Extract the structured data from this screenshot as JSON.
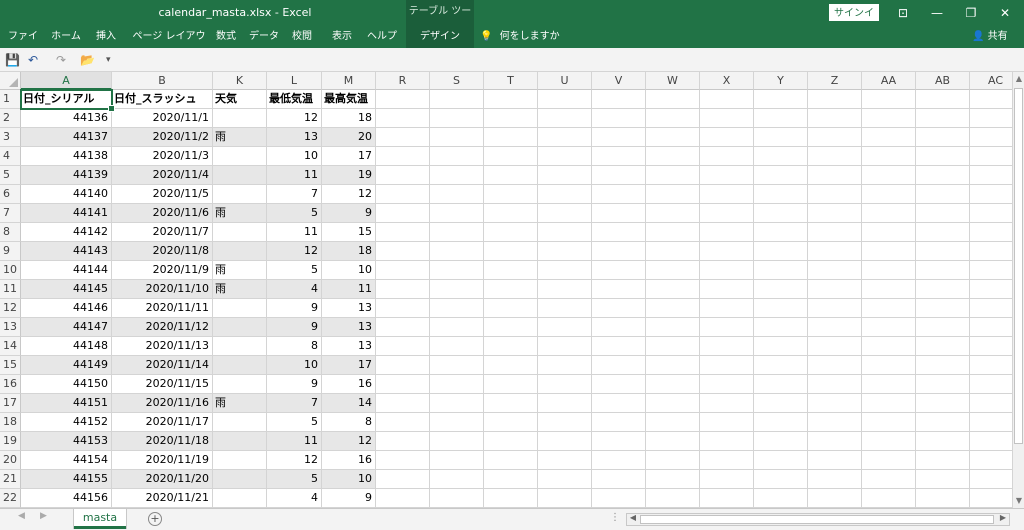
{
  "window": {
    "title": "calendar_masta.xlsx  -  Excel",
    "contextual_tab_label": "テーブル ツール",
    "signin_label": "サインイン",
    "controls": {
      "ribbon_options": "⊡",
      "minimize": "—",
      "restore": "❐",
      "close": "✕"
    }
  },
  "ribbon": {
    "tabs": [
      "ファイル",
      "ホーム",
      "挿入",
      "ページ レイアウト",
      "数式",
      "データ",
      "校閲",
      "表示",
      "ヘルプ",
      "デザイン"
    ],
    "tell_me": "何をしますか",
    "share": "共有"
  },
  "qat": {
    "save": "💾",
    "undo": "↶",
    "redo": "↷",
    "open": "📂",
    "customize": "▾"
  },
  "grid": {
    "columns": [
      "A",
      "B",
      "K",
      "L",
      "M",
      "R",
      "S",
      "T",
      "U",
      "V",
      "W",
      "X",
      "Y",
      "Z",
      "AA",
      "AB",
      "AC"
    ],
    "table_header": [
      "日付_シリアル",
      "日付_スラッシュ",
      "天気",
      "最低気温",
      "最高気温"
    ],
    "rows": [
      {
        "n": "2",
        "a": "44136",
        "b": "2020/11/1",
        "k": "",
        "l": "12",
        "m": "18"
      },
      {
        "n": "3",
        "a": "44137",
        "b": "2020/11/2",
        "k": "雨",
        "l": "13",
        "m": "20"
      },
      {
        "n": "4",
        "a": "44138",
        "b": "2020/11/3",
        "k": "",
        "l": "10",
        "m": "17"
      },
      {
        "n": "5",
        "a": "44139",
        "b": "2020/11/4",
        "k": "",
        "l": "11",
        "m": "19"
      },
      {
        "n": "6",
        "a": "44140",
        "b": "2020/11/5",
        "k": "",
        "l": "7",
        "m": "12"
      },
      {
        "n": "7",
        "a": "44141",
        "b": "2020/11/6",
        "k": "雨",
        "l": "5",
        "m": "9"
      },
      {
        "n": "8",
        "a": "44142",
        "b": "2020/11/7",
        "k": "",
        "l": "11",
        "m": "15"
      },
      {
        "n": "9",
        "a": "44143",
        "b": "2020/11/8",
        "k": "",
        "l": "12",
        "m": "18"
      },
      {
        "n": "10",
        "a": "44144",
        "b": "2020/11/9",
        "k": "雨",
        "l": "5",
        "m": "10"
      },
      {
        "n": "11",
        "a": "44145",
        "b": "2020/11/10",
        "k": "雨",
        "l": "4",
        "m": "11"
      },
      {
        "n": "12",
        "a": "44146",
        "b": "2020/11/11",
        "k": "",
        "l": "9",
        "m": "13"
      },
      {
        "n": "13",
        "a": "44147",
        "b": "2020/11/12",
        "k": "",
        "l": "9",
        "m": "13"
      },
      {
        "n": "14",
        "a": "44148",
        "b": "2020/11/13",
        "k": "",
        "l": "8",
        "m": "13"
      },
      {
        "n": "15",
        "a": "44149",
        "b": "2020/11/14",
        "k": "",
        "l": "10",
        "m": "17"
      },
      {
        "n": "16",
        "a": "44150",
        "b": "2020/11/15",
        "k": "",
        "l": "9",
        "m": "16"
      },
      {
        "n": "17",
        "a": "44151",
        "b": "2020/11/16",
        "k": "雨",
        "l": "7",
        "m": "14"
      },
      {
        "n": "18",
        "a": "44152",
        "b": "2020/11/17",
        "k": "",
        "l": "5",
        "m": "8"
      },
      {
        "n": "19",
        "a": "44153",
        "b": "2020/11/18",
        "k": "",
        "l": "11",
        "m": "12"
      },
      {
        "n": "20",
        "a": "44154",
        "b": "2020/11/19",
        "k": "",
        "l": "12",
        "m": "16"
      },
      {
        "n": "21",
        "a": "44155",
        "b": "2020/11/20",
        "k": "",
        "l": "5",
        "m": "10"
      },
      {
        "n": "22",
        "a": "44156",
        "b": "2020/11/21",
        "k": "",
        "l": "4",
        "m": "9"
      }
    ]
  },
  "sheets": {
    "nav_prev": "◀",
    "nav_next": "▶",
    "tabs": [
      "masta"
    ],
    "add": "+",
    "more": "⋮"
  }
}
